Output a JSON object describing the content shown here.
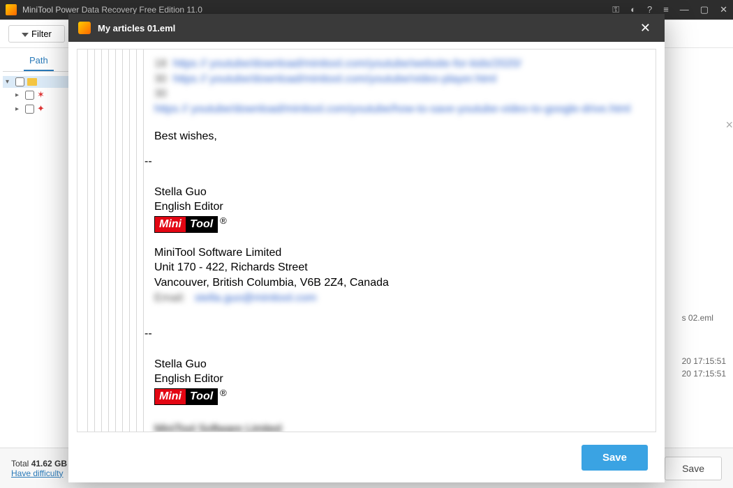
{
  "app": {
    "title": "MiniTool Power Data Recovery Free Edition 11.0"
  },
  "toolbar": {
    "filter_label": "Filter"
  },
  "sidebar": {
    "tab_label": "Path"
  },
  "right_panel": {
    "file_name": "s 02.eml",
    "date1": "20 17:15:51",
    "date2": "20 17:15:51"
  },
  "statusbar": {
    "total_prefix": "Total ",
    "total_value": "41.62 GB",
    "help_link": "Have difficulty",
    "save_label": "Save"
  },
  "modal": {
    "title": "My articles 01.eml",
    "save_label": "Save"
  },
  "email": {
    "link1_num": "18",
    "link1_text": "https // youtube/download/minitool.com/youtube/website-for-kids/2020/",
    "link2_num": "30",
    "link2_text": "https // youtube/download/minitool.com/youtube/video-player.html",
    "link3_num": "30",
    "link3_text": "https // youtube/download/minitool.com/youtube/how-to-save-youtube-video-to-google-drive.html",
    "best_wishes": "Best wishes,",
    "dashes": "--",
    "name": "Stella Guo",
    "role": "English Editor",
    "logo_mini": "Mini",
    "logo_tool": "Tool",
    "reg": "®",
    "company": "MiniTool Software Limited",
    "addr1": "Unit 170 - 422, Richards Street",
    "addr2": "Vancouver, British Columbia, V6B 2Z4, Canada",
    "email_label": "Email:",
    "email_value": "stella.guo@minitool.com"
  }
}
